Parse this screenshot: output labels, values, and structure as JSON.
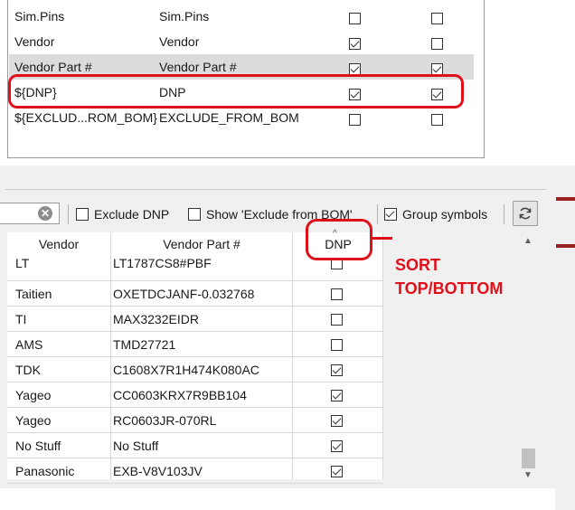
{
  "fields_table": {
    "rows": [
      {
        "field": "Sim.Pins",
        "label": "Sim.Pins",
        "show": false,
        "group_by": false,
        "selected": false
      },
      {
        "field": "Vendor",
        "label": "Vendor",
        "show": true,
        "group_by": false,
        "selected": false
      },
      {
        "field": "Vendor Part #",
        "label": "Vendor Part #",
        "show": true,
        "group_by": true,
        "selected": true
      },
      {
        "field": "${DNP}",
        "label": "DNP",
        "show": true,
        "group_by": true,
        "selected": false
      },
      {
        "field": "${EXCLUD...ROM_BOM}",
        "label": "EXCLUDE_FROM_BOM",
        "show": false,
        "group_by": false,
        "selected": false
      }
    ]
  },
  "toolbar": {
    "exclude_dnp_label": "Exclude DNP",
    "exclude_dnp_checked": false,
    "show_excluded_label": "Show 'Exclude from BOM'",
    "show_excluded_checked": false,
    "group_symbols_label": "Group symbols",
    "group_symbols_checked": true,
    "clear_icon": "✕",
    "refresh_icon": "refresh-icon"
  },
  "grid": {
    "columns": [
      "Vendor",
      "Vendor Part #",
      "DNP"
    ],
    "sort_indicator": "^",
    "rows": [
      {
        "vendor": "LT",
        "part": "LT1787CS8#PBF",
        "dnp": false
      },
      {
        "vendor": "Taitien",
        "part": "OXETDCJANF-0.032768",
        "dnp": false
      },
      {
        "vendor": "TI",
        "part": "MAX3232EIDR",
        "dnp": false
      },
      {
        "vendor": "AMS",
        "part": "TMD27721",
        "dnp": false
      },
      {
        "vendor": "TDK",
        "part": "C1608X7R1H474K080AC",
        "dnp": true
      },
      {
        "vendor": "Yageo",
        "part": "CC0603KRX7R9BB104",
        "dnp": true
      },
      {
        "vendor": "Yageo",
        "part": "RC0603JR-070RL",
        "dnp": true
      },
      {
        "vendor": "No Stuff",
        "part": "No Stuff",
        "dnp": true
      },
      {
        "vendor": "Panasonic",
        "part": "EXB-V8V103JV",
        "dnp": true
      }
    ]
  },
  "annotation": {
    "line1": "SORT",
    "line2": "TOP/BOTTOM",
    "color": "#e0101a"
  }
}
